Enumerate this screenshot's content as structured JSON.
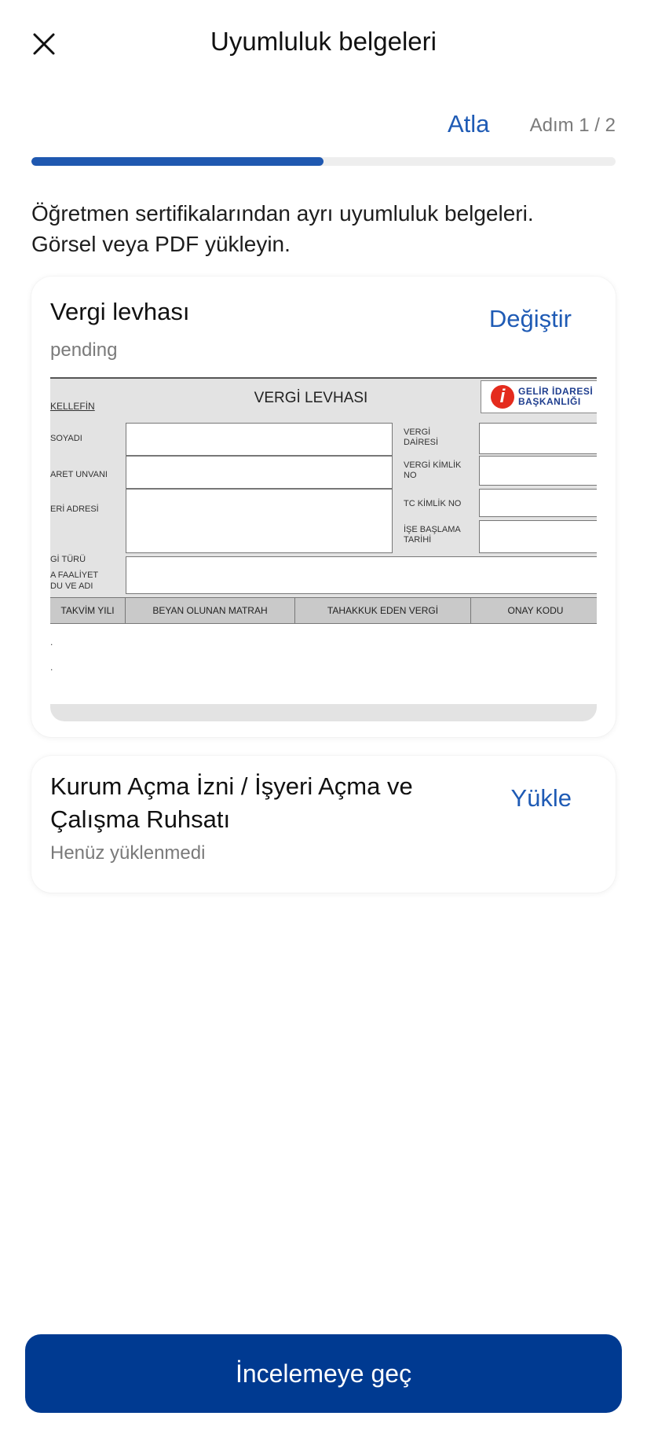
{
  "header": {
    "title": "Uyumluluk belgeleri",
    "close_icon": "close-icon"
  },
  "progress": {
    "skip_label": "Atla",
    "step_text": "Adım 1 / 2",
    "fraction": 0.5,
    "fill_color": "#1f58b0"
  },
  "description": {
    "line1": "Öğretmen sertifikalarından ayrı uyumluluk belgeleri.",
    "line2": "Görsel veya PDF yükleyin."
  },
  "documents": [
    {
      "title": "Vergi levhası",
      "status": "pending",
      "action": "Değiştir",
      "preview": {
        "heading": "VERGİ LEVHASI",
        "mukellef": "KELLEFİN",
        "logo_line1": "GELİR İDARESİ",
        "logo_line2": "BAŞKANLIĞI",
        "left_labels": [
          "SOYADI",
          "ARET UNVANI",
          "ERİ ADRESİ",
          "Gİ TÜRÜ",
          "A FAALİYET",
          "DU VE ADI"
        ],
        "right_labels": [
          "VERGİ",
          "DAİRESİ",
          "VERGİ KİMLİK",
          "NO",
          "TC KİMLİK NO",
          "İŞE BAŞLAMA",
          "TARİHİ"
        ],
        "columns": [
          "TAKVİM YILI",
          "BEYAN OLUNAN MATRAH",
          "TAHAKKUK EDEN VERGİ",
          "ONAY KODU"
        ],
        "row_marks": [
          ".",
          "."
        ]
      }
    },
    {
      "title_line1": "Kurum Açma İzni / İşyeri Açma ve",
      "title_line2": "Çalışma Ruhsatı",
      "status": "Henüz yüklenmedi",
      "action": "Yükle"
    }
  ],
  "primary_button": {
    "label": "İncelemeye geç",
    "color": "#003a91"
  },
  "colors": {
    "accent": "#1f5bb5",
    "muted_text": "#7a7a7a"
  }
}
